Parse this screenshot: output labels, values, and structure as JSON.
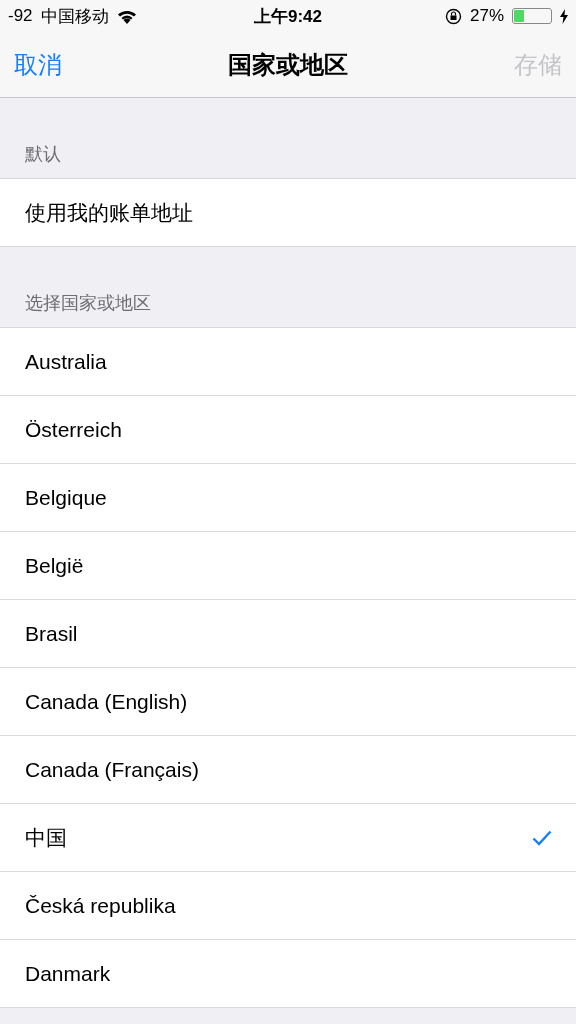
{
  "status_bar": {
    "signal": "-92",
    "carrier": "中国移动",
    "time": "上午9:42",
    "battery": "27%"
  },
  "nav": {
    "cancel": "取消",
    "title": "国家或地区",
    "save": {
      "label": "存储",
      "disabled": true
    }
  },
  "sections": [
    {
      "header": "默认",
      "items": [
        {
          "label": "使用我的账单地址",
          "selected": false
        }
      ]
    },
    {
      "header": "选择国家或地区",
      "items": [
        {
          "label": "Australia",
          "selected": false
        },
        {
          "label": "Österreich",
          "selected": false
        },
        {
          "label": "Belgique",
          "selected": false
        },
        {
          "label": "België",
          "selected": false
        },
        {
          "label": "Brasil",
          "selected": false
        },
        {
          "label": "Canada (English)",
          "selected": false
        },
        {
          "label": "Canada (Français)",
          "selected": false
        },
        {
          "label": "中国",
          "selected": true
        },
        {
          "label": "Česká republika",
          "selected": false
        },
        {
          "label": "Danmark",
          "selected": false
        }
      ]
    }
  ]
}
